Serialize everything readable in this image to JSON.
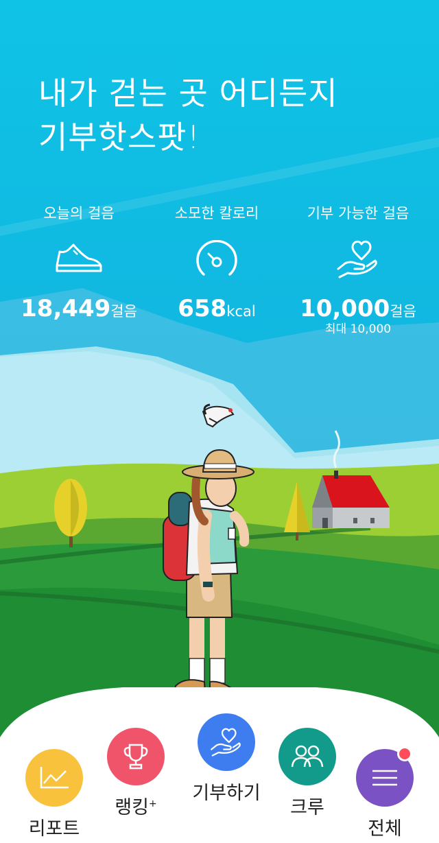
{
  "headline": {
    "line1": "내가 걷는 곳 어디든지",
    "line2": "기부핫스팟!"
  },
  "stats": {
    "steps": {
      "label": "오늘의 걸음",
      "value": "18,449",
      "unit": "걸음",
      "icon": "sneaker-icon"
    },
    "calories": {
      "label": "소모한 칼로리",
      "value": "658",
      "unit": "kcal",
      "icon": "gauge-icon"
    },
    "donatable": {
      "label": "기부 가능한 걸음",
      "value": "10,000",
      "unit": "걸음",
      "max": "최대 10,000",
      "icon": "heart-hand-icon"
    }
  },
  "nav": {
    "report": {
      "label": "리포트",
      "color": "#f9c23c",
      "icon": "line-chart-icon"
    },
    "ranking": {
      "label": "랭킹",
      "sup": "+",
      "color": "#f0546b",
      "icon": "trophy-icon"
    },
    "donate": {
      "label": "기부하기",
      "color": "#3d7df0",
      "icon": "heart-hand-icon"
    },
    "crew": {
      "label": "크루",
      "color": "#129b8b",
      "icon": "people-icon"
    },
    "all": {
      "label": "전체",
      "color": "#7b52c4",
      "badge_color": "#ff4d5e",
      "icon": "menu-icon"
    }
  },
  "colors": {
    "sky": "#16b8de",
    "grass": "#2a9a3a",
    "roof": "#d9141c"
  }
}
